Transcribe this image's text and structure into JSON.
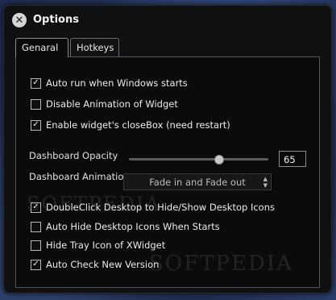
{
  "window": {
    "title": "Options"
  },
  "tabs": [
    {
      "label": "Genaral",
      "active": true
    },
    {
      "label": "Hotkeys",
      "active": false
    }
  ],
  "options_top": [
    {
      "label": "Auto run when Windows starts",
      "checked": true
    },
    {
      "label": "Disable Animation of Widget",
      "checked": false
    },
    {
      "label": "Enable widget's closeBox  (need restart)",
      "checked": true
    }
  ],
  "opacity": {
    "label": "Dashboard Opacity",
    "value": "65",
    "slider_fraction": 0.65
  },
  "animation": {
    "label": "Dashboard  Animatio",
    "selected": "Fade in and Fade out"
  },
  "options_bottom": [
    {
      "label": "DoubleClick Desktop to Hide/Show Desktop Icons",
      "checked": true
    },
    {
      "label": "Auto Hide Desktop Icons When Starts",
      "checked": false
    },
    {
      "label": "Hide Tray Icon of XWidget",
      "checked": false
    },
    {
      "label": "Auto Check New Version",
      "checked": true
    }
  ],
  "watermarks": [
    "SOFTPEDIA",
    "SOFTPEDIA"
  ],
  "icons": {
    "close": "close-icon",
    "check": "check-icon",
    "select_arrows": "updown-arrows-icon"
  },
  "colors": {
    "window_bg": "#0f1012",
    "desktop": "#23335c",
    "text": "#e8e8e8"
  }
}
